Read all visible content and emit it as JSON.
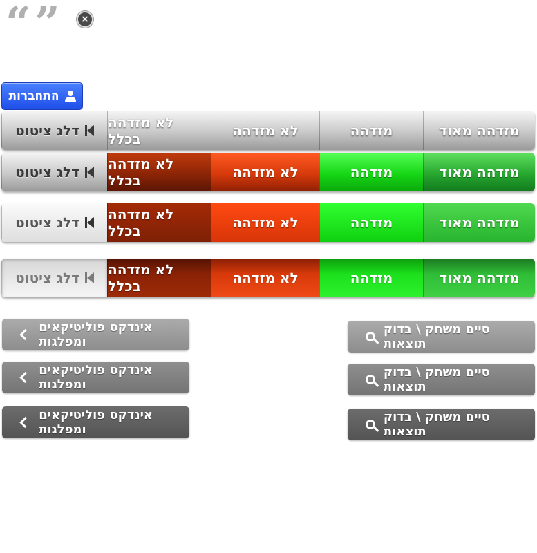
{
  "close_button": {
    "label": "×"
  },
  "login": {
    "label": "התחברות"
  },
  "rating_rows": [
    {
      "labels": [
        "מזדהה מאוד",
        "מזדהה",
        "לא מזדהה",
        "לא מזדהה בכלל"
      ],
      "skip": "דלג ציטוט"
    },
    {
      "labels": [
        "מזדהה מאוד",
        "מזדהה",
        "לא מזדהה",
        "לא מזדהה בכלל"
      ],
      "skip": "דלג ציטוט"
    },
    {
      "labels": [
        "מזדהה מאוד",
        "מזדהה",
        "לא מזדהה",
        "לא מזדהה בכלל"
      ],
      "skip": "דלג ציטוט"
    },
    {
      "labels": [
        "מזדהה מאוד",
        "מזדהה",
        "לא מזדהה",
        "לא מזדהה בכלל"
      ],
      "skip": "דלג ציטוט"
    }
  ],
  "index_buttons": [
    "אינדקס פוליטיקאים ומפלגות",
    "אינדקס פוליטיקאים ומפלגות",
    "אינדקס פוליטיקאים ומפלגות"
  ],
  "finish_buttons": [
    "סיים משחק \\ בדוק תוצאות",
    "סיים משחק \\ בדוק תוצאות",
    "סיים משחק \\ בדוק תוצאות"
  ]
}
